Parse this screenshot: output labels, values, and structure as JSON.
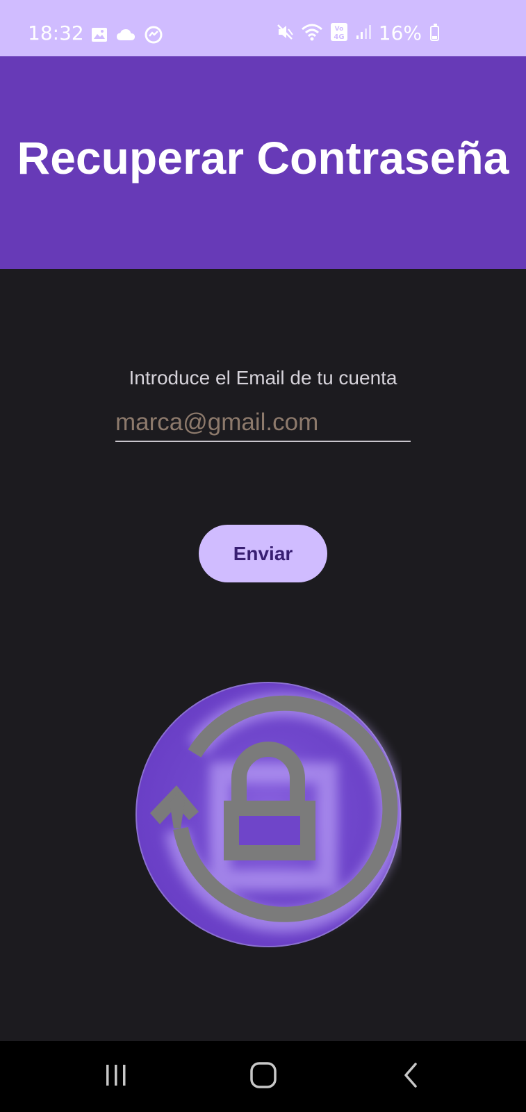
{
  "status_bar": {
    "time": "18:32",
    "battery_text": "16%",
    "left_icons": [
      "gallery-icon",
      "cloud-icon",
      "messenger-icon"
    ],
    "right_icons": [
      "mute-icon",
      "wifi-icon",
      "volte-4g-icon",
      "signal-icon",
      "battery-icon"
    ]
  },
  "header": {
    "title": "Recuperar Contraseña"
  },
  "form": {
    "email_label": "Introduce el Email de tu cuenta",
    "email_value": "marca@gmail.com",
    "send_label": "Enviar"
  },
  "illustration": {
    "icon": "lock-reset-icon"
  },
  "nav_bar": {
    "buttons": [
      "recent-apps",
      "home",
      "back"
    ]
  },
  "colors": {
    "status_bar_bg": "#d0bcff",
    "header_bg": "#673ab7",
    "background": "#1c1b1f",
    "button_bg": "#d0bcff",
    "button_text": "#381e72",
    "input_text": "#8d7a6c",
    "label_text": "#d6d3da",
    "icon_circle": "#673ab7",
    "icon_symbol": "#7b7b7b"
  }
}
